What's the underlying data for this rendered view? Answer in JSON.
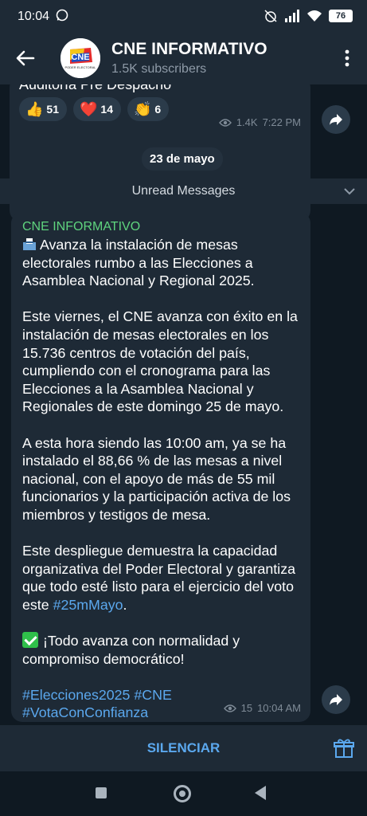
{
  "status_bar": {
    "time": "10:04",
    "battery": "76"
  },
  "header": {
    "title": "CNE INFORMATIVO",
    "subscribers": "1.5K subscribers",
    "avatar_text": "CNE",
    "avatar_subtext": "PODER ELECTORAL"
  },
  "prev_message": {
    "text": "Auditoría Pre Despacho",
    "reactions": [
      {
        "emoji": "👍",
        "count": "51"
      },
      {
        "emoji": "❤️",
        "count": "14"
      },
      {
        "emoji": "👏",
        "count": "6"
      }
    ],
    "views": "1.4K",
    "time": "7:22 PM"
  },
  "date_separator": "23 de mayo",
  "unread_label": "Unread Messages",
  "message": {
    "author": "CNE INFORMATIVO",
    "p1": "Avanza la instalación de mesas electorales rumbo a las Elecciones a Asamblea Nacional y Regional 2025.",
    "p2": "Este viernes, el CNE avanza con éxito en la instalación de mesas electorales en los 15.736 centros de votación del país, cumpliendo con el cronograma para las Elecciones a la Asamblea Nacional y Regionales de este domingo 25 de mayo.",
    "p3": "A esta hora siendo las 10:00 am, ya se ha instalado el 88,66 % de las mesas a nivel nacional, con el apoyo de más de 55 mil funcionarios y la participación activa de los miembros y testigos de mesa.",
    "p4_text": "Este despliegue demuestra la capacidad organizativa del Poder Electoral y garantiza que todo esté listo para el ejercicio del voto este ",
    "p4_tag": "#25mMayo",
    "p4_end": ".",
    "p5": "¡Todo avanza con normalidad y compromiso democrático!",
    "tags_line1": "#Elecciones2025 #CNE",
    "tags_line2": "#VotaConConfianza",
    "views": "15",
    "time": "10:04 AM"
  },
  "bottom": {
    "mute_label": "SILENCIAR"
  }
}
